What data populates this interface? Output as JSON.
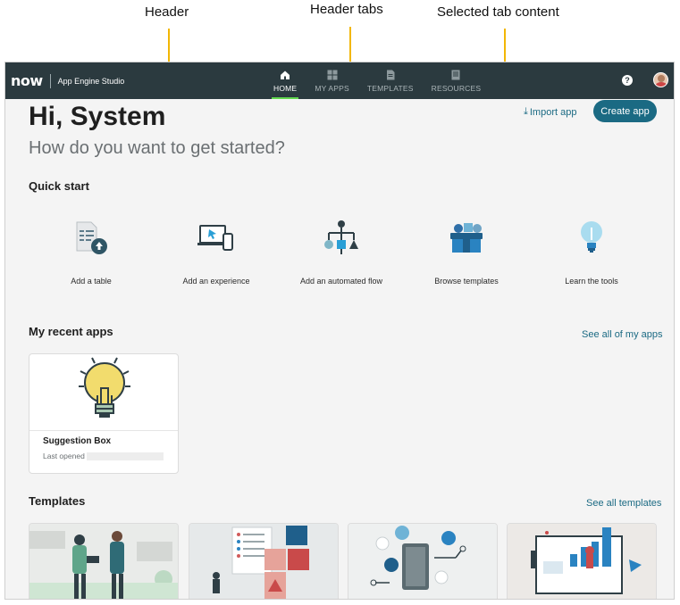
{
  "annotations": {
    "header": "Header",
    "header_tabs": "Header tabs",
    "selected_tab_content": "Selected tab content"
  },
  "topbar": {
    "logo": "now",
    "product": "App Engine Studio",
    "tabs": [
      {
        "label": "HOME",
        "icon": "home-icon",
        "active": true
      },
      {
        "label": "MY APPS",
        "icon": "grid-icon",
        "active": false
      },
      {
        "label": "TEMPLATES",
        "icon": "document-icon",
        "active": false
      },
      {
        "label": "RESOURCES",
        "icon": "book-icon",
        "active": false
      }
    ],
    "help": "?"
  },
  "main": {
    "greeting": "Hi, System",
    "subtitle": "How do you want to get started?",
    "import_label": "Import app",
    "create_label": "Create app",
    "quick_start": {
      "heading": "Quick start",
      "items": [
        {
          "label": "Add a table",
          "icon": "table-upload-icon"
        },
        {
          "label": "Add an experience",
          "icon": "devices-icon"
        },
        {
          "label": "Add an automated flow",
          "icon": "flow-icon"
        },
        {
          "label": "Browse templates",
          "icon": "templates-box-icon"
        },
        {
          "label": "Learn the tools",
          "icon": "lightbulb-icon"
        }
      ]
    },
    "recent_apps": {
      "heading": "My recent apps",
      "see_all": "See all of my apps",
      "cards": [
        {
          "title": "Suggestion Box",
          "meta": "Last opened",
          "icon": "lightbulb-icon"
        }
      ]
    },
    "templates": {
      "heading": "Templates",
      "see_all": "See all templates"
    }
  },
  "colors": {
    "header_bg": "#2b3a3f",
    "accent": "#1b6a83",
    "active_tab": "#62d84e",
    "callout_arrow": "#f2b705"
  }
}
